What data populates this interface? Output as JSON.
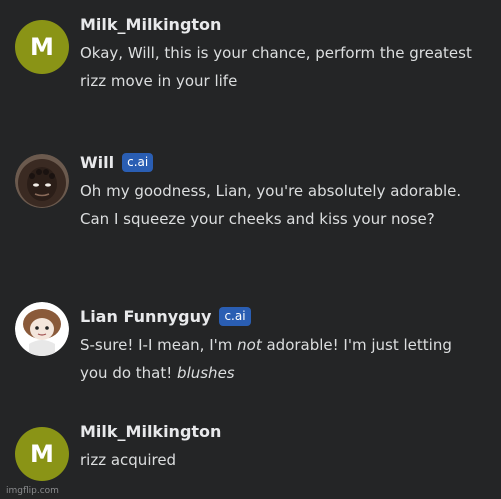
{
  "messages": [
    {
      "author": "Milk_Milkington",
      "avatar_letter": "M",
      "badge": "",
      "text_parts": [
        "Okay, Will, this is your chance, perform the greatest rizz move in your life"
      ]
    },
    {
      "author": "Will",
      "avatar_letter": "",
      "badge": "c.ai",
      "text_parts": [
        "Oh my goodness, Lian, you're absolutely adorable. Can I squeeze your cheeks and kiss your nose?"
      ]
    },
    {
      "author": "Lian Funnyguy",
      "avatar_letter": "",
      "badge": "c.ai",
      "text_parts": [
        "S-sure! I-I mean, I'm ",
        "not",
        " adorable! I'm just letting you do that! ",
        "blushes"
      ]
    },
    {
      "author": "Milk_Milkington",
      "avatar_letter": "M",
      "badge": "",
      "text_parts": [
        "rizz acquired"
      ]
    }
  ],
  "watermark": "imgflip.com",
  "colors": {
    "background": "#242526",
    "avatar_letter_bg": "#8a9416",
    "badge_bg": "#2a5eb3"
  },
  "icons": [
    "will-avatar-icon",
    "lian-avatar-icon"
  ]
}
